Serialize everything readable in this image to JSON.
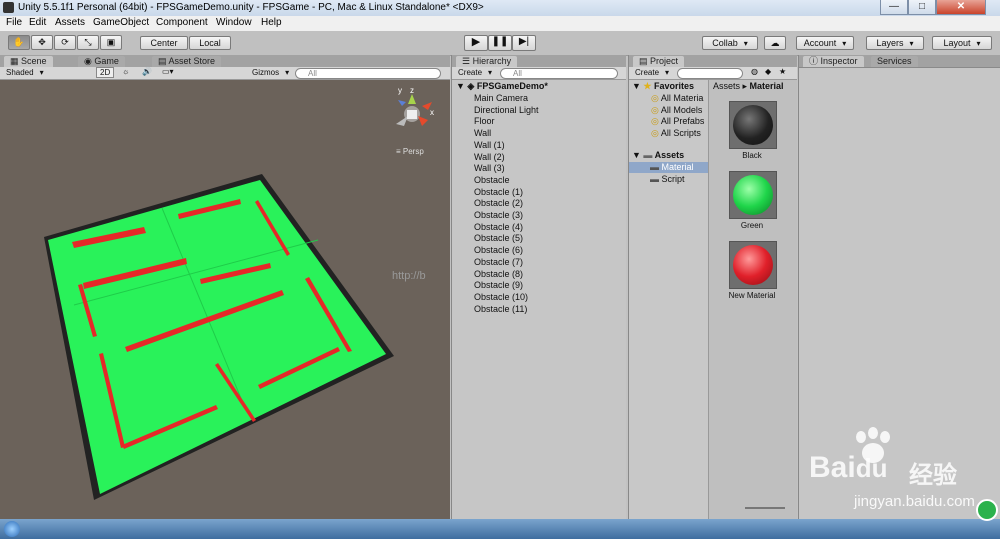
{
  "window": {
    "title": "Unity 5.5.1f1 Personal (64bit) - FPSGameDemo.unity - FPSGame - PC, Mac & Linux Standalone* <DX9>",
    "minimize": "—",
    "maximize": "□",
    "close": "✕"
  },
  "menu": [
    "File",
    "Edit",
    "Assets",
    "GameObject",
    "Component",
    "Window",
    "Help"
  ],
  "toolbar": {
    "center_label": "Center",
    "local_label": "Local",
    "collab_label": "Collab",
    "account_label": "Account",
    "layers_label": "Layers",
    "layout_label": "Layout"
  },
  "scene_panel": {
    "tabs": [
      "Scene",
      "Game",
      "Asset Store"
    ],
    "shading": "Shaded",
    "mode_2d": "2D",
    "gizmos": "Gizmos",
    "search_placeholder": "All",
    "persp_label": "Persp",
    "gizmo_axes": {
      "x": "x",
      "y": "y",
      "z": "z"
    },
    "colors": {
      "background": "#6b625a",
      "floor": "#29f25a",
      "walls": "#222222",
      "obstacles": "#e62828"
    }
  },
  "hierarchy": {
    "tab": "Hierarchy",
    "create_label": "Create",
    "search_placeholder": "All",
    "scene_name": "FPSGameDemo*",
    "items": [
      "Main Camera",
      "Directional Light",
      "Floor",
      "Wall",
      "Wall (1)",
      "Wall (2)",
      "Wall (3)",
      "Obstacle",
      "Obstacle (1)",
      "Obstacle (2)",
      "Obstacle (3)",
      "Obstacle (4)",
      "Obstacle (5)",
      "Obstacle (6)",
      "Obstacle (7)",
      "Obstacle (8)",
      "Obstacle (9)",
      "Obstacle (10)",
      "Obstacle (11)"
    ]
  },
  "project": {
    "tab": "Project",
    "create_label": "Create",
    "favorites_label": "Favorites",
    "favorites": [
      "All Materia",
      "All Models",
      "All Prefabs",
      "All Scripts"
    ],
    "assets_label": "Assets",
    "folders": [
      "Material",
      "Script"
    ],
    "selected_folder": "Material",
    "breadcrumb": [
      "Assets",
      "Material"
    ],
    "materials": [
      {
        "name": "Black",
        "color": "#222222"
      },
      {
        "name": "Green",
        "color": "#1fd54a"
      },
      {
        "name": "New Material",
        "color": "#e0202a"
      }
    ]
  },
  "inspector": {
    "tabs": [
      "Inspector",
      "Services"
    ]
  },
  "watermark": {
    "url": "http://b",
    "brand": "Bai",
    "brand_suffix": "经验",
    "site": "jingyan.baidu.com"
  }
}
